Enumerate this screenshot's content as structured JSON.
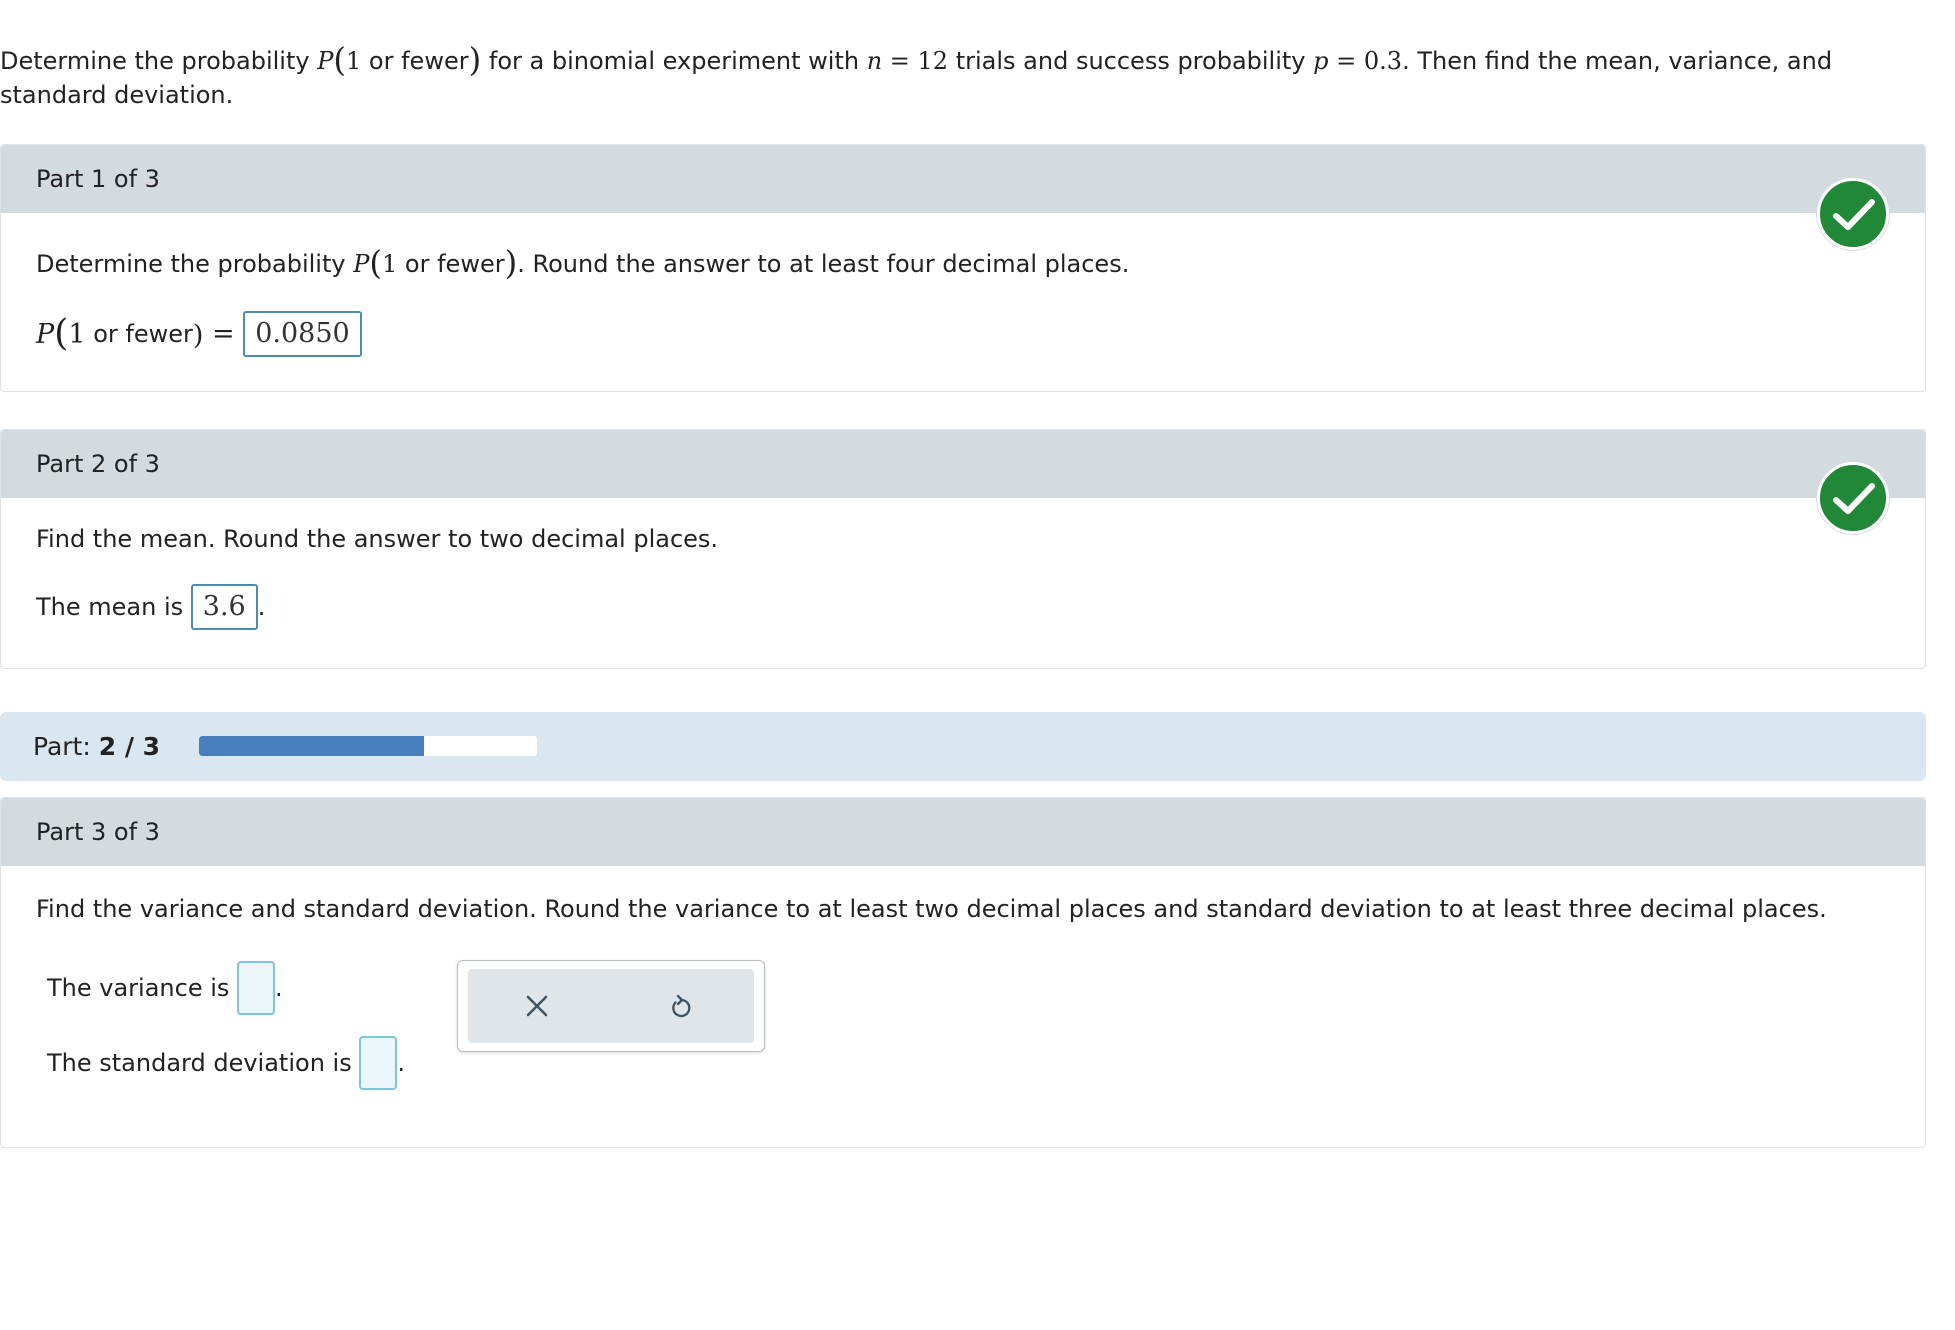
{
  "question": {
    "text_1": "Determine the probability ",
    "p_symbol": "P",
    "open_paren": "(",
    "one": "1",
    "or_fewer": " or fewer",
    "close_paren": ")",
    "text_2": " for a binomial experiment with ",
    "n_symbol": "n",
    "n_eq": " = 12",
    "text_3": " trials and success probability ",
    "p2_symbol": "p",
    "p_eq": " = 0.3",
    "text_4": ". Then find the mean, variance, and standard deviation."
  },
  "part1": {
    "header": "Part 1 of 3",
    "instruction_1": "Determine the probability ",
    "instruction_2": ". Round the answer to at least four decimal places.",
    "p_symbol": "P",
    "open_paren": "(",
    "one": "1",
    "or_fewer": " or fewer",
    "close_paren": ")",
    "equals": " = ",
    "answer": "0.0850",
    "status": "correct"
  },
  "part2": {
    "header": "Part 2 of 3",
    "instruction": "Find the mean. Round the answer to two decimal places.",
    "mean_label": "The mean is ",
    "answer": "3.6",
    "period": ".",
    "status": "correct"
  },
  "progress": {
    "label": "Part: ",
    "value_text": "2 / 3",
    "fraction": 0.6667,
    "fill_color": "#4a7fbf"
  },
  "part3": {
    "header": "Part 3 of 3",
    "instruction": "Find the variance and standard deviation. Round the variance to at least two decimal places and standard deviation to at least three decimal places.",
    "variance_label": "The variance is ",
    "variance_value": "",
    "std_label": "The standard deviation is ",
    "std_value": "",
    "period": "."
  },
  "tools": {
    "clear_icon": "close-icon",
    "undo_icon": "undo-icon"
  },
  "colors": {
    "header_bg": "#d3dbdf",
    "check_green": "#218838",
    "progress_bg": "#dbe7f0"
  }
}
